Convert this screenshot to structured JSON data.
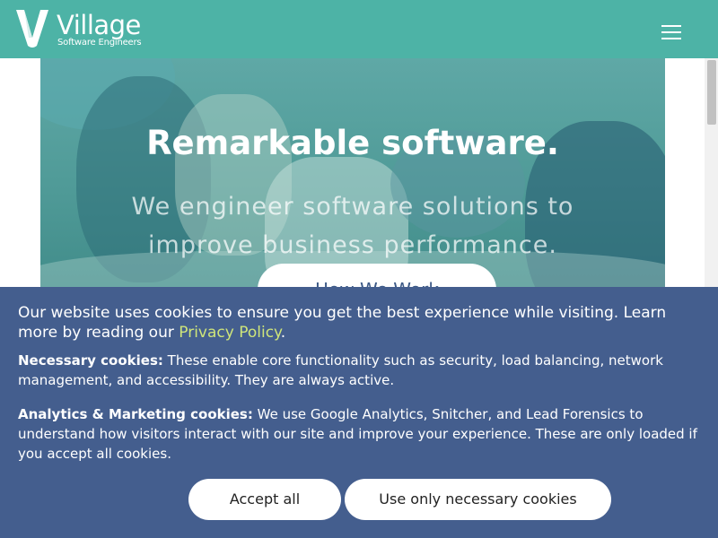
{
  "header": {
    "logo_name": "Village",
    "logo_tagline": "Software Engineers",
    "menu_icon": "hamburger-menu-icon"
  },
  "hero": {
    "title": "Remarkable software.",
    "subtitle": "We engineer software solutions to improve business performance.",
    "cta_label": "How We Work"
  },
  "cookie_banner": {
    "message": "Our website uses cookies to ensure you get the best experience while visiting. Learn more by reading our",
    "privacy_link": "Privacy Policy",
    "message_end": ".",
    "necessary_title": "Necessary cookies:",
    "necessary_text": "These enable core functionality such as security, load balancing, network management, and accessibility. They are always active.",
    "analytics_title": "Analytics & Marketing cookies:",
    "analytics_text": "We use Google Analytics, Snitcher, and Lead Forensics to understand how visitors interact with our site and improve your experience. These are only loaded if you accept all cookies.",
    "accept_all_label": "Accept all",
    "necessary_only_label": "Use only necessary cookies"
  },
  "colors": {
    "header_bg": "#4db3a6",
    "banner_bg": "#445e8e",
    "link": "#cfe57a",
    "button_text": "#3d5a87"
  }
}
